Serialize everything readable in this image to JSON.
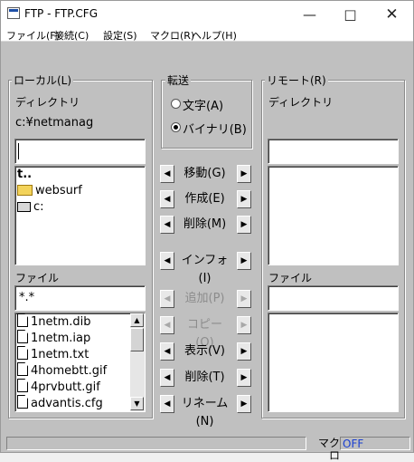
{
  "window": {
    "title": "FTP - FTP.CFG"
  },
  "menu": [
    "ファイル(F)",
    "接続(C)",
    "設定(S)",
    "マクロ(R)",
    "ヘルプ(H)"
  ],
  "local": {
    "group_label": "ローカル(L)",
    "dir_label": "ディレクトリ",
    "path": "c:¥netmanag",
    "dir_input": "",
    "dirs": [
      {
        "name": "t..",
        "icon": "parent-dir-icon"
      },
      {
        "name": "websurf",
        "icon": "folder-icon"
      },
      {
        "name": "c:",
        "icon": "drive-icon"
      }
    ],
    "file_label": "ファイル",
    "file_filter": "*.*",
    "files": [
      "1netm.dib",
      "1netm.iap",
      "1netm.txt",
      "4homebtt.gif",
      "4prvbutt.gif",
      "advantis.cfg"
    ]
  },
  "transfer": {
    "group_label": "転送",
    "option_text": "文字(A)",
    "option_binary": "バイナリ(B)",
    "selected": "binary"
  },
  "actions": [
    {
      "label": "移動(G)",
      "enabled": true
    },
    {
      "label": "作成(E)",
      "enabled": true
    },
    {
      "label": "削除(M)",
      "enabled": true
    },
    {
      "label": "インフォ(I)",
      "enabled": true
    },
    {
      "label": "追加(P)",
      "enabled": false
    },
    {
      "label": "コピー(O)",
      "enabled": false
    },
    {
      "label": "表示(V)",
      "enabled": true
    },
    {
      "label": "削除(T)",
      "enabled": true
    },
    {
      "label": "リネーム(N)",
      "enabled": true
    }
  ],
  "remote": {
    "group_label": "リモート(R)",
    "dir_label": "ディレクトリ",
    "file_label": "ファイル"
  },
  "status": {
    "macro_label": "マクロ",
    "macro_state": "OFF"
  },
  "colors": {
    "macro_state": "#1a3fd1",
    "folder": "#f3d35a"
  }
}
